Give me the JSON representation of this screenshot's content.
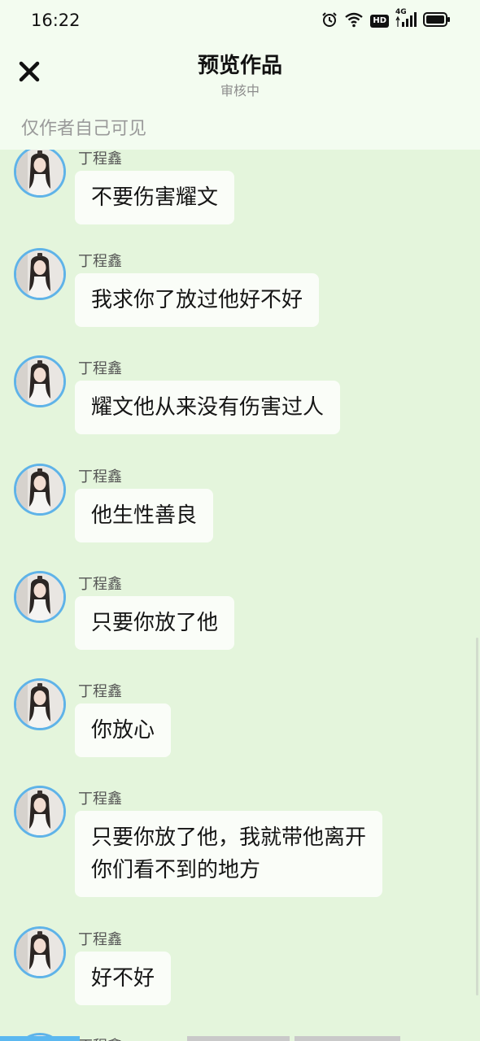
{
  "status_bar": {
    "time": "16:22",
    "network": "4G",
    "hd": "HD",
    "icons": [
      "alarm-icon",
      "wifi-icon",
      "hd-icon",
      "signal-icon",
      "battery-icon"
    ]
  },
  "header": {
    "title": "预览作品",
    "subtitle": "审核中",
    "visibility_note": "仅作者自己可见"
  },
  "messages": [
    {
      "sender": "丁程鑫",
      "lines": [
        "不要伤害耀文"
      ]
    },
    {
      "sender": "丁程鑫",
      "lines": [
        "我求你了放过他好不好"
      ]
    },
    {
      "sender": "丁程鑫",
      "lines": [
        "耀文他从来没有伤害过人"
      ]
    },
    {
      "sender": "丁程鑫",
      "lines": [
        "他生性善良"
      ]
    },
    {
      "sender": "丁程鑫",
      "lines": [
        "只要你放了他"
      ]
    },
    {
      "sender": "丁程鑫",
      "lines": [
        "你放心"
      ]
    },
    {
      "sender": "丁程鑫",
      "lines": [
        "只要你放了他，我就带他离开",
        "你们看不到的地方"
      ]
    },
    {
      "sender": "丁程鑫",
      "lines": [
        "好不好"
      ]
    },
    {
      "sender": "丁程鑫",
      "lines": [
        ""
      ]
    }
  ],
  "colors": {
    "background": "#e4f5dc",
    "header_background": "#f3fcf0",
    "bubble": "#fafdf8",
    "avatar_ring": "#5fb3e8",
    "bottom_accent": "#5bb8f0"
  }
}
